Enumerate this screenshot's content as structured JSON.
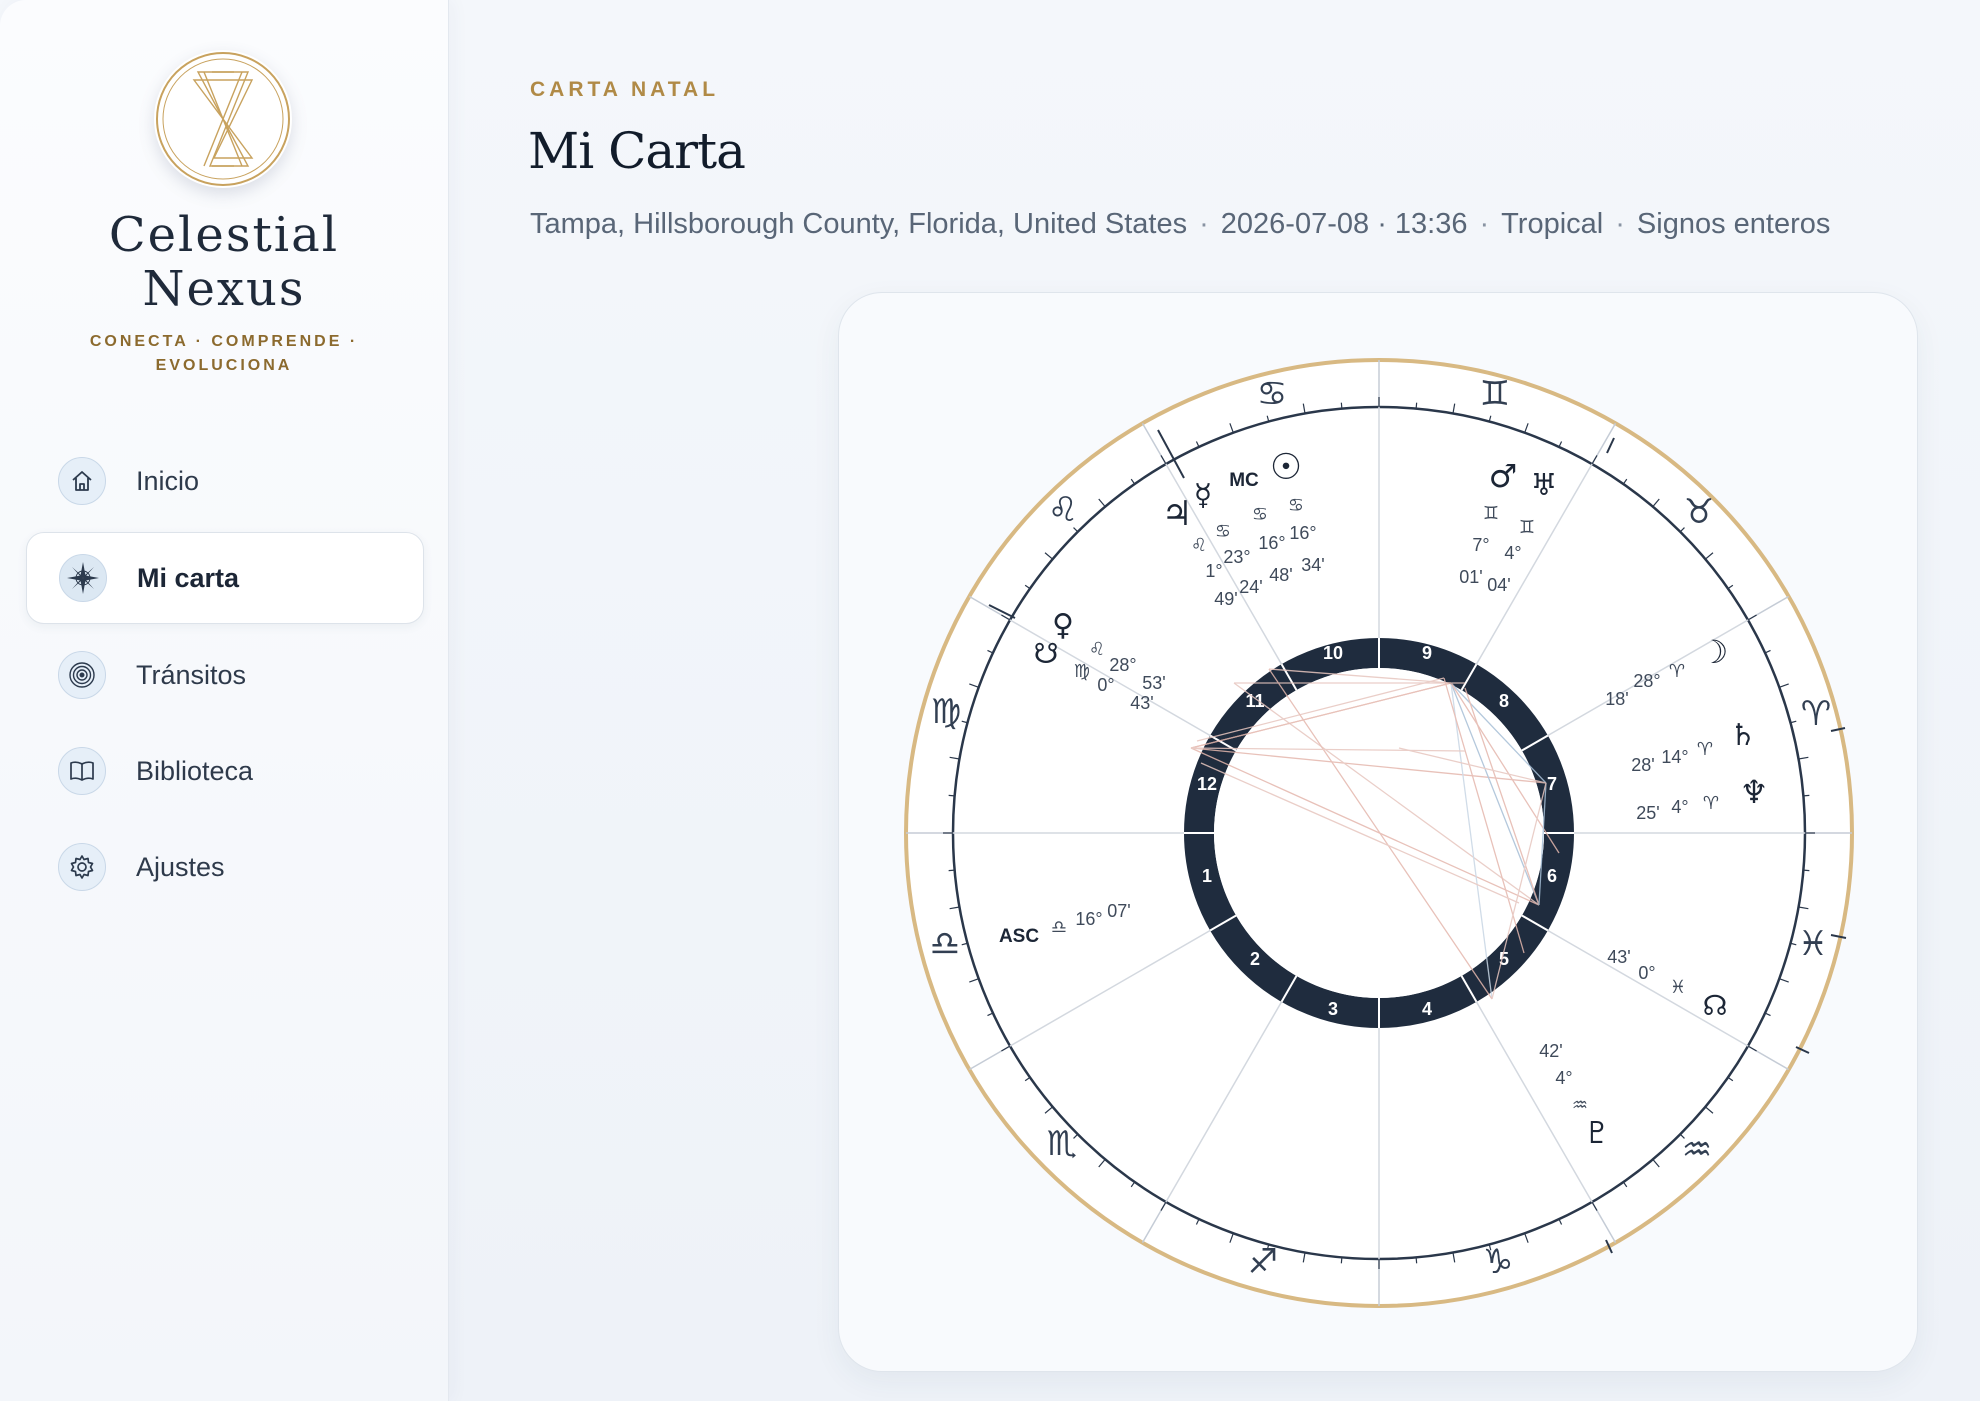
{
  "brand": {
    "name_line1": "Celestial",
    "name_line2": "Nexus",
    "tagline_line1": "CONECTA · COMPRENDE ·",
    "tagline_line2": "EVOLUCIONA"
  },
  "sidebar": {
    "items": [
      {
        "label": "Inicio",
        "icon": "home-icon",
        "active": false
      },
      {
        "label": "Mi carta",
        "icon": "compass-rose-icon",
        "active": true
      },
      {
        "label": "Tránsitos",
        "icon": "concentric-rings-icon",
        "active": false
      },
      {
        "label": "Biblioteca",
        "icon": "book-icon",
        "active": false
      },
      {
        "label": "Ajustes",
        "icon": "gear-icon",
        "active": false
      }
    ]
  },
  "header": {
    "eyebrow": "CARTA NATAL",
    "title": "Mi Carta",
    "location": "Tampa, Hillsborough County, Florida, United States",
    "datetime": "2026-07-08 · 13:36",
    "zodiac": "Tropical",
    "house_system": "Signos enteros",
    "separator": "·"
  },
  "chart": {
    "colors": {
      "gold_ring": "#d8b983",
      "navy": "#1f2c3e",
      "line": "#c9ced6",
      "aspect_red": "#e4b7ad",
      "aspect_blue": "#a7bfd6"
    },
    "angles": {
      "asc_label": "ASC",
      "mc_label": "MC"
    },
    "house_numbers": [
      "1",
      "2",
      "3",
      "4",
      "5",
      "6",
      "7",
      "8",
      "9",
      "10",
      "11",
      "12"
    ],
    "signs": [
      {
        "name": "aries",
        "glyph": "♈"
      },
      {
        "name": "taurus",
        "glyph": "♉"
      },
      {
        "name": "gemini",
        "glyph": "♊"
      },
      {
        "name": "cancer",
        "glyph": "♋"
      },
      {
        "name": "leo",
        "glyph": "♌"
      },
      {
        "name": "virgo",
        "glyph": "♍"
      },
      {
        "name": "libra",
        "glyph": "♎"
      },
      {
        "name": "scorpio",
        "glyph": "♏"
      },
      {
        "name": "sagittarius",
        "glyph": "♐"
      },
      {
        "name": "capricorn",
        "glyph": "♑"
      },
      {
        "name": "aquarius",
        "glyph": "♒"
      },
      {
        "name": "pisces",
        "glyph": "♓"
      }
    ],
    "placements": [
      {
        "body": "Sun",
        "glyph": "☉",
        "sign_glyph": "♋",
        "deg": "16°",
        "min": "34'"
      },
      {
        "body": "MC",
        "glyph": "MC",
        "sign_glyph": "♋",
        "deg": "16°",
        "min": "48'"
      },
      {
        "body": "Mercury",
        "glyph": "☿",
        "sign_glyph": "♋",
        "deg": "23°",
        "min": "24'"
      },
      {
        "body": "Jupiter",
        "glyph": "♃",
        "sign_glyph": "♌",
        "deg": "1°",
        "min": "49'"
      },
      {
        "body": "Venus",
        "glyph": "♀",
        "sign_glyph": "♌",
        "deg": "28°",
        "min": "53'"
      },
      {
        "body": "South Node",
        "glyph": "☋",
        "sign_glyph": "♍",
        "deg": "0°",
        "min": "43'"
      },
      {
        "body": "ASC",
        "glyph": "ASC",
        "sign_glyph": "♎",
        "deg": "16°",
        "min": "07'"
      },
      {
        "body": "Mars",
        "glyph": "♂",
        "sign_glyph": "♊",
        "deg": "7°",
        "min": "01'"
      },
      {
        "body": "Uranus",
        "glyph": "♅",
        "sign_glyph": "♊",
        "deg": "4°",
        "min": "04'"
      },
      {
        "body": "Moon",
        "glyph": "☽",
        "sign_glyph": "♈",
        "deg": "28°",
        "min": "18'"
      },
      {
        "body": "Saturn",
        "glyph": "♄",
        "sign_glyph": "♈",
        "deg": "14°",
        "min": "28'"
      },
      {
        "body": "Neptune",
        "glyph": "♆",
        "sign_glyph": "♈",
        "deg": "4°",
        "min": "25'"
      },
      {
        "body": "North Node",
        "glyph": "☊",
        "sign_glyph": "♓",
        "deg": "0°",
        "min": "43'"
      },
      {
        "body": "Pluto",
        "glyph": "♇",
        "sign_glyph": "♒",
        "deg": "4°",
        "min": "42'"
      }
    ]
  }
}
